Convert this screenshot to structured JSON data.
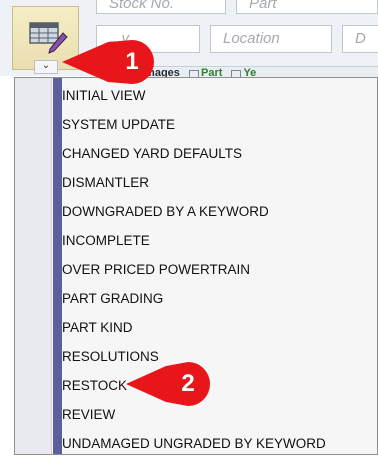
{
  "toolbar": {
    "stock_placeholder": "Stock No.",
    "part_placeholder": "Part",
    "left_field_placeholder": "...y",
    "location_placeholder": "Location",
    "right_field_placeholder": "D",
    "chevron_label": "⌄"
  },
  "grid_header": {
    "columns": [
      "Images",
      "Part",
      "Ye"
    ]
  },
  "menu": {
    "items": [
      "INITIAL VIEW",
      "SYSTEM UPDATE",
      "CHANGED YARD DEFAULTS",
      "DISMANTLER",
      "DOWNGRADED BY A KEYWORD",
      "INCOMPLETE",
      "OVER PRICED POWERTRAIN",
      "PART GRADING",
      "PART KIND",
      "RESOLUTIONS",
      "RESTOCK",
      "REVIEW",
      "UNDAMAGED UNGRADED BY KEYWORD"
    ]
  },
  "callouts": {
    "one": "1",
    "two": "2",
    "color": "#e8161b"
  },
  "colors": {
    "accent_bar": "#5b5f9e",
    "tab_background": "#f0e6bb"
  },
  "icons": {
    "tool": "grid-edit-icon",
    "chevron": "chevron-down-icon"
  }
}
